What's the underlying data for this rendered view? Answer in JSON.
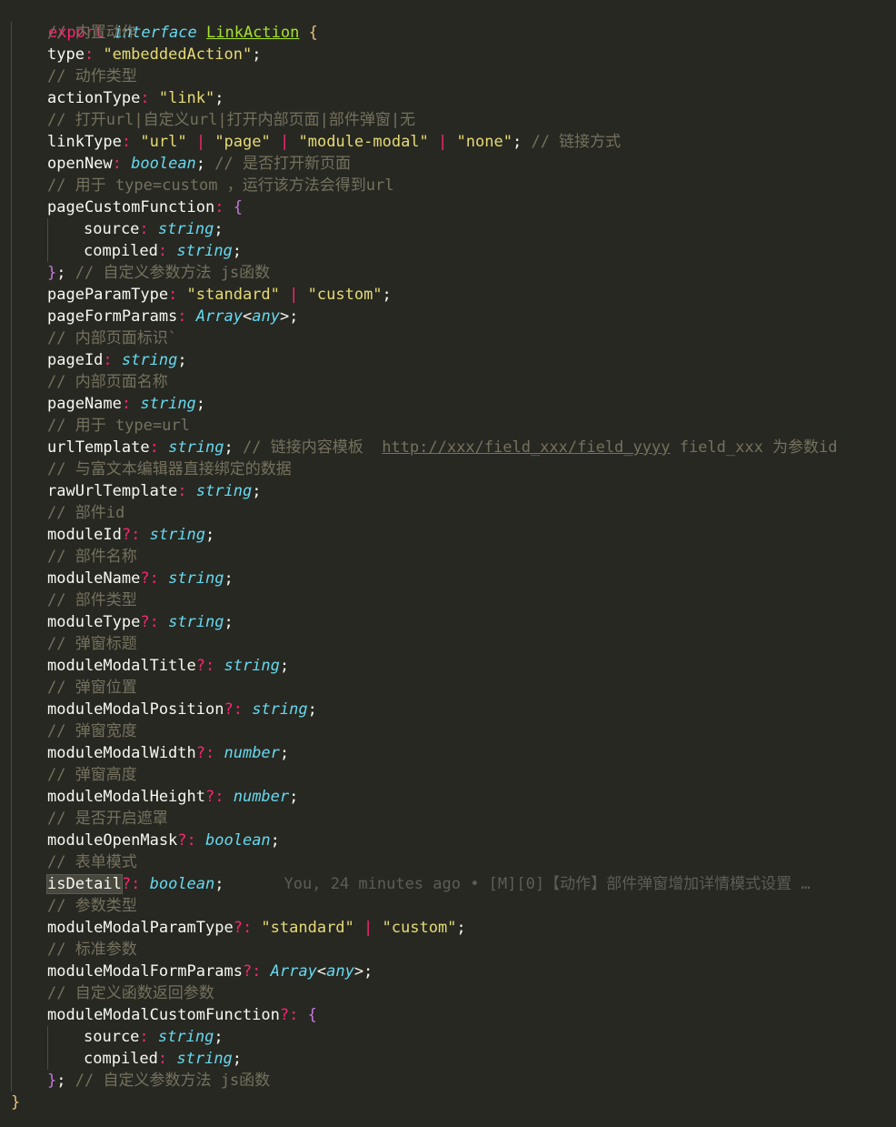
{
  "editor": {
    "lines": [
      {
        "id": "l0",
        "kind": "open",
        "text": "export interface LinkAction {"
      },
      {
        "id": "l1",
        "kind": "comment",
        "text": "// 内置动作"
      },
      {
        "id": "l2",
        "kind": "prop",
        "name": "type",
        "value": "\"embeddedAction\"",
        "suffix": ";"
      },
      {
        "id": "l3",
        "kind": "comment",
        "text": "// 动作类型"
      },
      {
        "id": "l4",
        "kind": "prop",
        "name": "actionType",
        "value": "\"link\"",
        "suffix": ";"
      },
      {
        "id": "l5",
        "kind": "comment",
        "text": "// 打开url|自定义url|打开内部页面|部件弹窗|无"
      },
      {
        "id": "l6",
        "kind": "special",
        "text": "linkType: \"url\" | \"page\" | \"module-modal\" | \"none\"; // 链接方式"
      },
      {
        "id": "l7",
        "kind": "special",
        "text": "openNew: boolean; // 是否打开新页面"
      },
      {
        "id": "l8",
        "kind": "comment",
        "text": "// 用于 type=custom ，运行该方法会得到url"
      },
      {
        "id": "l9",
        "kind": "special",
        "text": "pageCustomFunction: {"
      },
      {
        "id": "l10",
        "kind": "special",
        "text": "source: string;"
      },
      {
        "id": "l11",
        "kind": "special",
        "text": "compiled: string;"
      },
      {
        "id": "l12",
        "kind": "special",
        "text": "}; // 自定义参数方法 js函数"
      },
      {
        "id": "l13",
        "kind": "special",
        "text": "pageParamType: \"standard\" | \"custom\";"
      },
      {
        "id": "l14",
        "kind": "special",
        "text": "pageFormParams: Array<any>;"
      },
      {
        "id": "l15",
        "kind": "comment",
        "text": "// 内部页面标识`"
      },
      {
        "id": "l16",
        "kind": "special",
        "text": "pageId: string;"
      },
      {
        "id": "l17",
        "kind": "comment",
        "text": "// 内部页面名称"
      },
      {
        "id": "l18",
        "kind": "special",
        "text": "pageName: string;"
      },
      {
        "id": "l19",
        "kind": "comment",
        "text": "// 用于 type=url"
      },
      {
        "id": "l20",
        "kind": "special",
        "text": "urlTemplate: string; // 链接内容模板  http://xxx/field_xxx/field_yyyy field_xxx 为参数id"
      },
      {
        "id": "l21",
        "kind": "comment",
        "text": "// 与富文本编辑器直接绑定的数据"
      },
      {
        "id": "l22",
        "kind": "special",
        "text": "rawUrlTemplate: string;"
      },
      {
        "id": "l23",
        "kind": "comment",
        "text": "// 部件id"
      },
      {
        "id": "l24",
        "kind": "special",
        "text": "moduleId?: string;"
      },
      {
        "id": "l25",
        "kind": "comment",
        "text": "// 部件名称"
      },
      {
        "id": "l26",
        "kind": "special",
        "text": "moduleName?: string;"
      },
      {
        "id": "l27",
        "kind": "comment",
        "text": "// 部件类型"
      },
      {
        "id": "l28",
        "kind": "special",
        "text": "moduleType?: string;"
      },
      {
        "id": "l29",
        "kind": "comment",
        "text": "// 弹窗标题"
      },
      {
        "id": "l30",
        "kind": "special",
        "text": "moduleModalTitle?: string;"
      },
      {
        "id": "l31",
        "kind": "comment",
        "text": "// 弹窗位置"
      },
      {
        "id": "l32",
        "kind": "special",
        "text": "moduleModalPosition?: string;"
      },
      {
        "id": "l33",
        "kind": "comment",
        "text": "// 弹窗宽度"
      },
      {
        "id": "l34",
        "kind": "special",
        "text": "moduleModalWidth?: number;"
      },
      {
        "id": "l35",
        "kind": "comment",
        "text": "// 弹窗高度"
      },
      {
        "id": "l36",
        "kind": "special",
        "text": "moduleModalHeight?: number;"
      },
      {
        "id": "l37",
        "kind": "comment",
        "text": "// 是否开启遮罩"
      },
      {
        "id": "l38",
        "kind": "special",
        "text": "moduleOpenMask?: boolean;"
      },
      {
        "id": "l39",
        "kind": "comment",
        "text": "// 表单模式"
      },
      {
        "id": "l40",
        "kind": "special",
        "text": "isDetail?: boolean;"
      },
      {
        "id": "l41",
        "kind": "comment",
        "text": "// 参数类型"
      },
      {
        "id": "l42",
        "kind": "special",
        "text": "moduleModalParamType?: \"standard\" | \"custom\";"
      },
      {
        "id": "l43",
        "kind": "comment",
        "text": "// 标准参数"
      },
      {
        "id": "l44",
        "kind": "special",
        "text": "moduleModalFormParams?: Array<any>;"
      },
      {
        "id": "l45",
        "kind": "comment",
        "text": "// 自定义函数返回参数"
      },
      {
        "id": "l46",
        "kind": "special",
        "text": "moduleModalCustomFunction?: {"
      },
      {
        "id": "l47",
        "kind": "special",
        "text": "source: string;"
      },
      {
        "id": "l48",
        "kind": "special",
        "text": "compiled: string;"
      },
      {
        "id": "l49",
        "kind": "special",
        "text": "}; // 自定义参数方法 js函数"
      },
      {
        "id": "l50",
        "kind": "close",
        "text": "}"
      }
    ],
    "blame": "You, 24 minutes ago • [M][0]【动作】部件弹窗增加详情模式设置 …"
  },
  "colors": {
    "background": "#272822",
    "keyword": "#f92672",
    "type": "#66d9ef",
    "string": "#e6db74",
    "comment": "#75715e",
    "identifier": "#a6e22e"
  }
}
